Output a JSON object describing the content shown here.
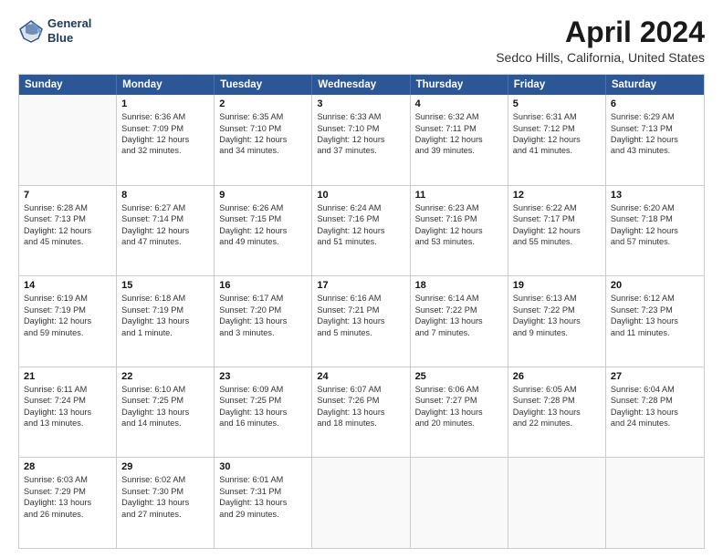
{
  "header": {
    "logo_line1": "General",
    "logo_line2": "Blue",
    "title": "April 2024",
    "subtitle": "Sedco Hills, California, United States"
  },
  "weekdays": [
    "Sunday",
    "Monday",
    "Tuesday",
    "Wednesday",
    "Thursday",
    "Friday",
    "Saturday"
  ],
  "weeks": [
    [
      {
        "day": null
      },
      {
        "day": "1",
        "sunrise": "Sunrise: 6:36 AM",
        "sunset": "Sunset: 7:09 PM",
        "daylight": "Daylight: 12 hours",
        "daylight2": "and 32 minutes."
      },
      {
        "day": "2",
        "sunrise": "Sunrise: 6:35 AM",
        "sunset": "Sunset: 7:10 PM",
        "daylight": "Daylight: 12 hours",
        "daylight2": "and 34 minutes."
      },
      {
        "day": "3",
        "sunrise": "Sunrise: 6:33 AM",
        "sunset": "Sunset: 7:10 PM",
        "daylight": "Daylight: 12 hours",
        "daylight2": "and 37 minutes."
      },
      {
        "day": "4",
        "sunrise": "Sunrise: 6:32 AM",
        "sunset": "Sunset: 7:11 PM",
        "daylight": "Daylight: 12 hours",
        "daylight2": "and 39 minutes."
      },
      {
        "day": "5",
        "sunrise": "Sunrise: 6:31 AM",
        "sunset": "Sunset: 7:12 PM",
        "daylight": "Daylight: 12 hours",
        "daylight2": "and 41 minutes."
      },
      {
        "day": "6",
        "sunrise": "Sunrise: 6:29 AM",
        "sunset": "Sunset: 7:13 PM",
        "daylight": "Daylight: 12 hours",
        "daylight2": "and 43 minutes."
      }
    ],
    [
      {
        "day": "7",
        "sunrise": "Sunrise: 6:28 AM",
        "sunset": "Sunset: 7:13 PM",
        "daylight": "Daylight: 12 hours",
        "daylight2": "and 45 minutes."
      },
      {
        "day": "8",
        "sunrise": "Sunrise: 6:27 AM",
        "sunset": "Sunset: 7:14 PM",
        "daylight": "Daylight: 12 hours",
        "daylight2": "and 47 minutes."
      },
      {
        "day": "9",
        "sunrise": "Sunrise: 6:26 AM",
        "sunset": "Sunset: 7:15 PM",
        "daylight": "Daylight: 12 hours",
        "daylight2": "and 49 minutes."
      },
      {
        "day": "10",
        "sunrise": "Sunrise: 6:24 AM",
        "sunset": "Sunset: 7:16 PM",
        "daylight": "Daylight: 12 hours",
        "daylight2": "and 51 minutes."
      },
      {
        "day": "11",
        "sunrise": "Sunrise: 6:23 AM",
        "sunset": "Sunset: 7:16 PM",
        "daylight": "Daylight: 12 hours",
        "daylight2": "and 53 minutes."
      },
      {
        "day": "12",
        "sunrise": "Sunrise: 6:22 AM",
        "sunset": "Sunset: 7:17 PM",
        "daylight": "Daylight: 12 hours",
        "daylight2": "and 55 minutes."
      },
      {
        "day": "13",
        "sunrise": "Sunrise: 6:20 AM",
        "sunset": "Sunset: 7:18 PM",
        "daylight": "Daylight: 12 hours",
        "daylight2": "and 57 minutes."
      }
    ],
    [
      {
        "day": "14",
        "sunrise": "Sunrise: 6:19 AM",
        "sunset": "Sunset: 7:19 PM",
        "daylight": "Daylight: 12 hours",
        "daylight2": "and 59 minutes."
      },
      {
        "day": "15",
        "sunrise": "Sunrise: 6:18 AM",
        "sunset": "Sunset: 7:19 PM",
        "daylight": "Daylight: 13 hours",
        "daylight2": "and 1 minute."
      },
      {
        "day": "16",
        "sunrise": "Sunrise: 6:17 AM",
        "sunset": "Sunset: 7:20 PM",
        "daylight": "Daylight: 13 hours",
        "daylight2": "and 3 minutes."
      },
      {
        "day": "17",
        "sunrise": "Sunrise: 6:16 AM",
        "sunset": "Sunset: 7:21 PM",
        "daylight": "Daylight: 13 hours",
        "daylight2": "and 5 minutes."
      },
      {
        "day": "18",
        "sunrise": "Sunrise: 6:14 AM",
        "sunset": "Sunset: 7:22 PM",
        "daylight": "Daylight: 13 hours",
        "daylight2": "and 7 minutes."
      },
      {
        "day": "19",
        "sunrise": "Sunrise: 6:13 AM",
        "sunset": "Sunset: 7:22 PM",
        "daylight": "Daylight: 13 hours",
        "daylight2": "and 9 minutes."
      },
      {
        "day": "20",
        "sunrise": "Sunrise: 6:12 AM",
        "sunset": "Sunset: 7:23 PM",
        "daylight": "Daylight: 13 hours",
        "daylight2": "and 11 minutes."
      }
    ],
    [
      {
        "day": "21",
        "sunrise": "Sunrise: 6:11 AM",
        "sunset": "Sunset: 7:24 PM",
        "daylight": "Daylight: 13 hours",
        "daylight2": "and 13 minutes."
      },
      {
        "day": "22",
        "sunrise": "Sunrise: 6:10 AM",
        "sunset": "Sunset: 7:25 PM",
        "daylight": "Daylight: 13 hours",
        "daylight2": "and 14 minutes."
      },
      {
        "day": "23",
        "sunrise": "Sunrise: 6:09 AM",
        "sunset": "Sunset: 7:25 PM",
        "daylight": "Daylight: 13 hours",
        "daylight2": "and 16 minutes."
      },
      {
        "day": "24",
        "sunrise": "Sunrise: 6:07 AM",
        "sunset": "Sunset: 7:26 PM",
        "daylight": "Daylight: 13 hours",
        "daylight2": "and 18 minutes."
      },
      {
        "day": "25",
        "sunrise": "Sunrise: 6:06 AM",
        "sunset": "Sunset: 7:27 PM",
        "daylight": "Daylight: 13 hours",
        "daylight2": "and 20 minutes."
      },
      {
        "day": "26",
        "sunrise": "Sunrise: 6:05 AM",
        "sunset": "Sunset: 7:28 PM",
        "daylight": "Daylight: 13 hours",
        "daylight2": "and 22 minutes."
      },
      {
        "day": "27",
        "sunrise": "Sunrise: 6:04 AM",
        "sunset": "Sunset: 7:28 PM",
        "daylight": "Daylight: 13 hours",
        "daylight2": "and 24 minutes."
      }
    ],
    [
      {
        "day": "28",
        "sunrise": "Sunrise: 6:03 AM",
        "sunset": "Sunset: 7:29 PM",
        "daylight": "Daylight: 13 hours",
        "daylight2": "and 26 minutes."
      },
      {
        "day": "29",
        "sunrise": "Sunrise: 6:02 AM",
        "sunset": "Sunset: 7:30 PM",
        "daylight": "Daylight: 13 hours",
        "daylight2": "and 27 minutes."
      },
      {
        "day": "30",
        "sunrise": "Sunrise: 6:01 AM",
        "sunset": "Sunset: 7:31 PM",
        "daylight": "Daylight: 13 hours",
        "daylight2": "and 29 minutes."
      },
      {
        "day": null
      },
      {
        "day": null
      },
      {
        "day": null
      },
      {
        "day": null
      }
    ]
  ]
}
